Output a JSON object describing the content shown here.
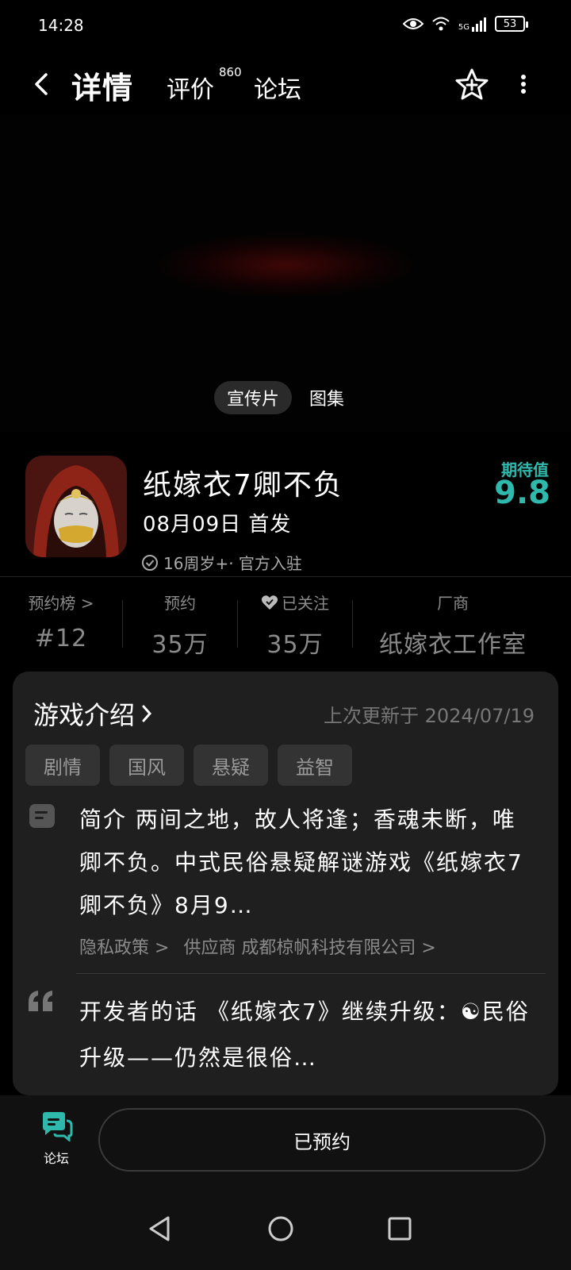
{
  "status_bar": {
    "time": "14:28",
    "network": "5G",
    "battery": "53"
  },
  "nav": {
    "tab_detail": "详情",
    "tab_review": "评价",
    "review_count": "860",
    "tab_forum": "论坛",
    "icons": [
      "back-arrow-icon",
      "favorite-star-add-icon",
      "more-dots-icon"
    ]
  },
  "media": {
    "tabs": [
      "宣传片",
      "图集"
    ],
    "active_tab": "宣传片"
  },
  "game": {
    "title": "纸嫁衣7卿不负",
    "release": "08月09日 首发",
    "meta": "16周岁+· 官方入驻",
    "expect_label": "期待值",
    "expect_score": "9.8"
  },
  "stats": [
    {
      "label": "预约榜 >",
      "value": "#12"
    },
    {
      "label": "预约",
      "value": "35万"
    },
    {
      "label": "已关注",
      "value": "35万"
    },
    {
      "label": "厂商",
      "value": "纸嫁衣工作室"
    }
  ],
  "intro": {
    "title": "游戏介绍",
    "updated": "上次更新于 2024/07/19",
    "tags": [
      "剧情",
      "国风",
      "悬疑",
      "益智"
    ],
    "description": "简介 两间之地，故人将逢；香魂未断，唯卿不负。中式民俗悬疑解谜游戏《纸嫁衣7卿不负》8月9…",
    "privacy_link": "隐私政策 >",
    "supplier_link": "供应商 成都椋帆科技有限公司 >",
    "dev_words": "开发者的话 《纸嫁衣7》继续升级：☯民俗升级——仍然是很俗…"
  },
  "bottom": {
    "forum_label": "论坛",
    "reserve_label": "已预约"
  },
  "colors": {
    "accent": "#2fb8ac",
    "background": "#000000",
    "card": "#1f1f1f",
    "tag_bg": "#333333",
    "muted_text": "#8a8a8a"
  }
}
